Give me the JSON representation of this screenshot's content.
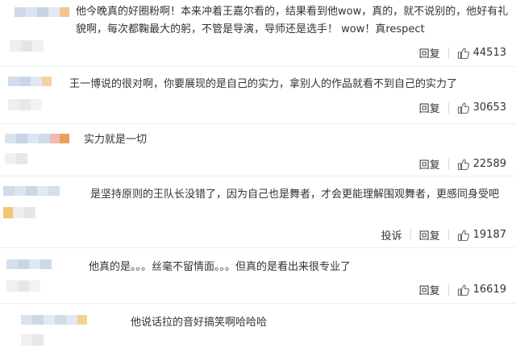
{
  "comments": [
    {
      "text": "他今晚真的好圈粉啊！本来冲着王嘉尔看的，结果看到他wow，真的，就不说别的，他好有礼貌啊，每次都鞠最大的躬，不管是导演，导师还是选手！ wow！真respect",
      "reply": "回复",
      "likes": "44513"
    },
    {
      "text": "王一博说的很对啊，你要展现的是自己的实力，拿别人的作品就看不到自己的实力了",
      "reply": "回复",
      "likes": "30653"
    },
    {
      "text": "实力就是一切",
      "reply": "回复",
      "likes": "22589"
    },
    {
      "text": "是坚持原则的王队长没错了，因为自己也是舞者，才会更能理解围观舞者，更感同身受吧",
      "report": "投诉",
      "reply": "回复",
      "likes": "19187"
    },
    {
      "text": "他真的是。。。丝毫不留情面。。。但真的是看出来很专业了",
      "reply": "回复",
      "likes": "16619"
    },
    {
      "text": "他说话拉的音好搞笑啊哈哈哈"
    }
  ],
  "colors": {
    "text": "#333333",
    "divider": "#eeeeee",
    "blur_blue": "#c9d8ea",
    "blur_orange": "#f2a65a",
    "blur_gray": "#e4e4e4"
  },
  "icons": {
    "like": "thumbs-up-icon"
  }
}
